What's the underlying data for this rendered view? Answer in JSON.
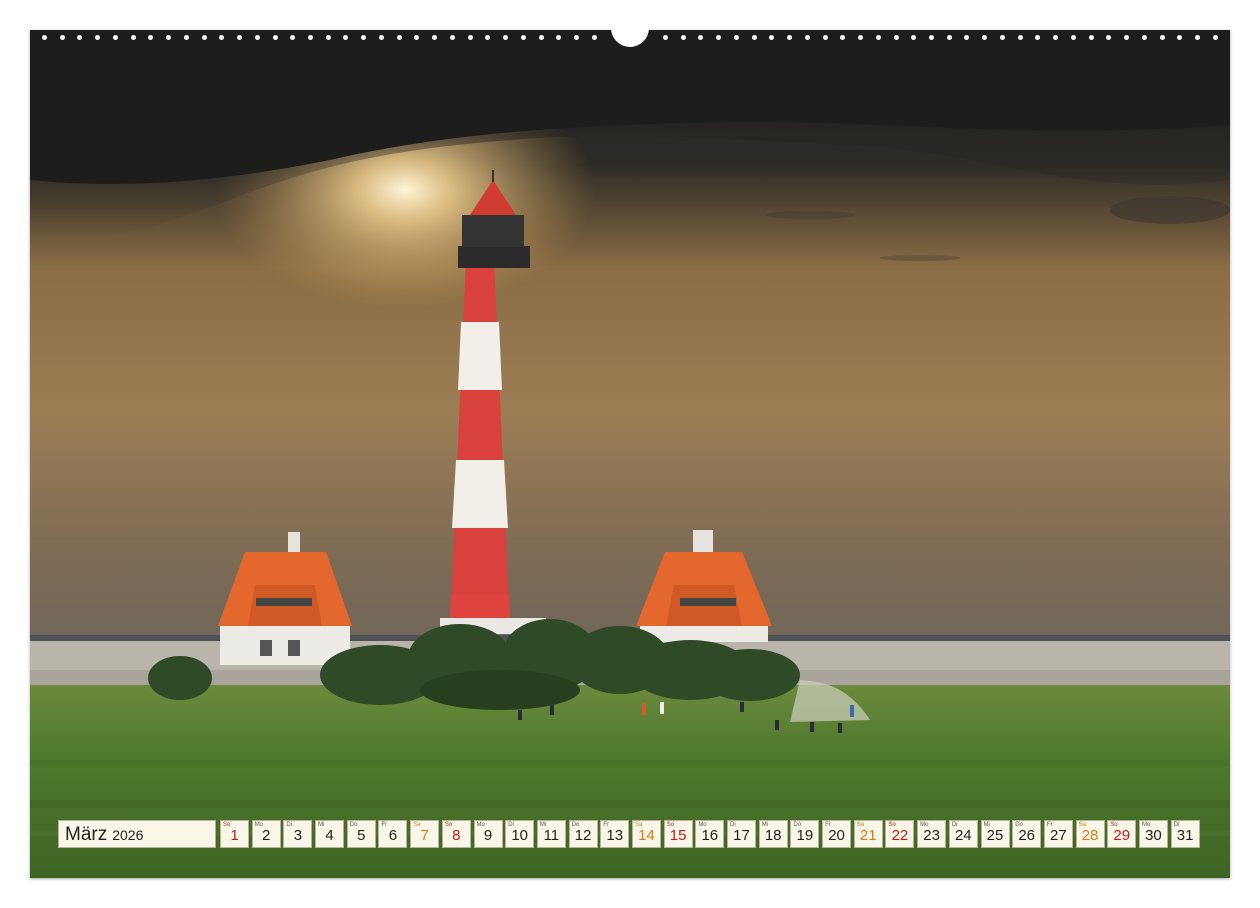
{
  "calendar": {
    "month": "März",
    "year": "2026",
    "days": [
      {
        "wd": "So",
        "n": "1",
        "type": "sun"
      },
      {
        "wd": "Mo",
        "n": "2",
        "type": ""
      },
      {
        "wd": "Di",
        "n": "3",
        "type": ""
      },
      {
        "wd": "Mi",
        "n": "4",
        "type": ""
      },
      {
        "wd": "Do",
        "n": "5",
        "type": ""
      },
      {
        "wd": "Fr",
        "n": "6",
        "type": ""
      },
      {
        "wd": "Sa",
        "n": "7",
        "type": "sat"
      },
      {
        "wd": "So",
        "n": "8",
        "type": "sun"
      },
      {
        "wd": "Mo",
        "n": "9",
        "type": ""
      },
      {
        "wd": "Di",
        "n": "10",
        "type": ""
      },
      {
        "wd": "Mi",
        "n": "11",
        "type": ""
      },
      {
        "wd": "Do",
        "n": "12",
        "type": ""
      },
      {
        "wd": "Fr",
        "n": "13",
        "type": ""
      },
      {
        "wd": "Sa",
        "n": "14",
        "type": "sat"
      },
      {
        "wd": "So",
        "n": "15",
        "type": "sun"
      },
      {
        "wd": "Mo",
        "n": "16",
        "type": ""
      },
      {
        "wd": "Di",
        "n": "17",
        "type": ""
      },
      {
        "wd": "Mi",
        "n": "18",
        "type": ""
      },
      {
        "wd": "Do",
        "n": "19",
        "type": ""
      },
      {
        "wd": "Fr",
        "n": "20",
        "type": ""
      },
      {
        "wd": "Sa",
        "n": "21",
        "type": "sat"
      },
      {
        "wd": "So",
        "n": "22",
        "type": "sun"
      },
      {
        "wd": "Mo",
        "n": "23",
        "type": ""
      },
      {
        "wd": "Di",
        "n": "24",
        "type": ""
      },
      {
        "wd": "Mi",
        "n": "25",
        "type": ""
      },
      {
        "wd": "Do",
        "n": "26",
        "type": ""
      },
      {
        "wd": "Fr",
        "n": "27",
        "type": ""
      },
      {
        "wd": "Sa",
        "n": "28",
        "type": "sat"
      },
      {
        "wd": "So",
        "n": "29",
        "type": "sun"
      },
      {
        "wd": "Mo",
        "n": "30",
        "type": ""
      },
      {
        "wd": "Di",
        "n": "31",
        "type": ""
      }
    ]
  },
  "colors": {
    "sunday": "#c41a1a",
    "saturday": "#e07818",
    "cell_background": "#fbf7e8"
  },
  "photo": {
    "subject_icon": "lighthouse-icon"
  }
}
